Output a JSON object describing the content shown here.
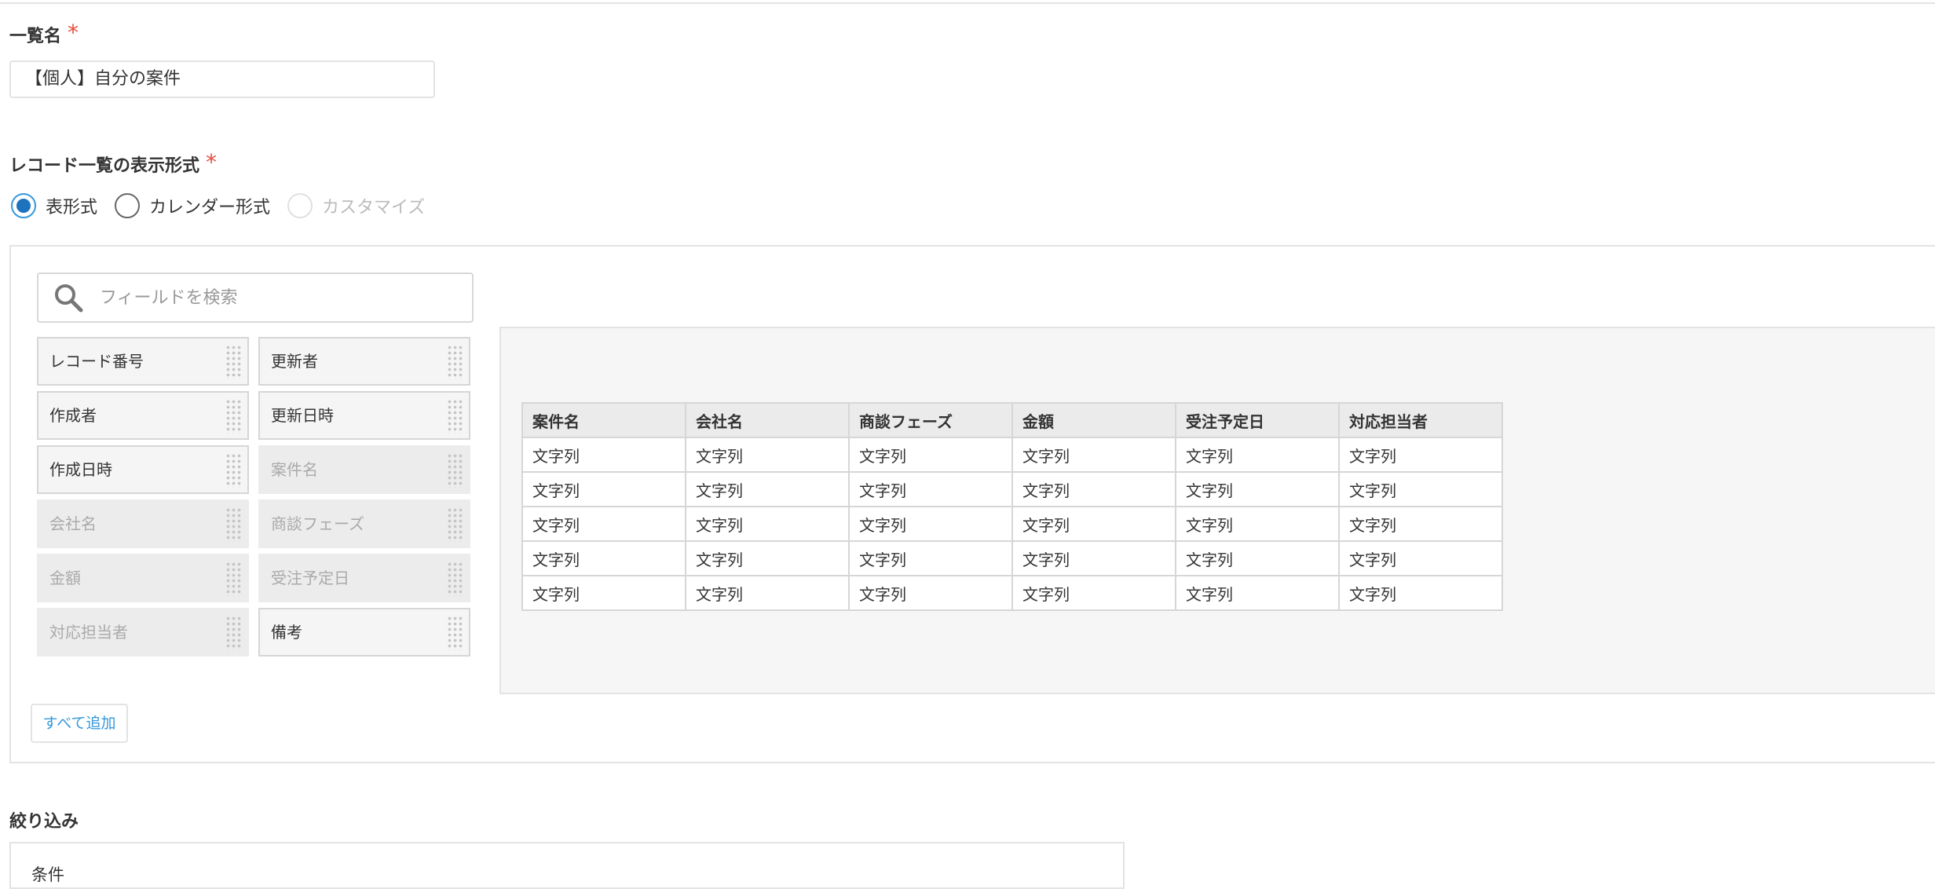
{
  "list_name": {
    "label": "一覧名",
    "required_mark": "*",
    "value": "【個人】自分の案件"
  },
  "display_format": {
    "label": "レコード一覧の表示形式",
    "required_mark": "*",
    "options": [
      {
        "label": "表形式",
        "checked": true,
        "disabled": false
      },
      {
        "label": "カレンダー形式",
        "checked": false,
        "disabled": false
      },
      {
        "label": "カスタマイズ",
        "checked": false,
        "disabled": true
      }
    ]
  },
  "field_search": {
    "placeholder": "フィールドを検索",
    "icon": "search-icon"
  },
  "fields": [
    {
      "label": "レコード番号",
      "used": false
    },
    {
      "label": "更新者",
      "used": false
    },
    {
      "label": "作成者",
      "used": false
    },
    {
      "label": "更新日時",
      "used": false
    },
    {
      "label": "作成日時",
      "used": false
    },
    {
      "label": "案件名",
      "used": true
    },
    {
      "label": "会社名",
      "used": true
    },
    {
      "label": "商談フェーズ",
      "used": true
    },
    {
      "label": "金額",
      "used": true
    },
    {
      "label": "受注予定日",
      "used": true
    },
    {
      "label": "対応担当者",
      "used": true
    },
    {
      "label": "備考",
      "used": false
    }
  ],
  "add_all_button": "すべて追加",
  "preview_table": {
    "columns": [
      "案件名",
      "会社名",
      "商談フェーズ",
      "金額",
      "受注予定日",
      "対応担当者"
    ],
    "rows": [
      [
        "文字列",
        "文字列",
        "文字列",
        "文字列",
        "文字列",
        "文字列"
      ],
      [
        "文字列",
        "文字列",
        "文字列",
        "文字列",
        "文字列",
        "文字列"
      ],
      [
        "文字列",
        "文字列",
        "文字列",
        "文字列",
        "文字列",
        "文字列"
      ],
      [
        "文字列",
        "文字列",
        "文字列",
        "文字列",
        "文字列",
        "文字列"
      ],
      [
        "文字列",
        "文字列",
        "文字列",
        "文字列",
        "文字列",
        "文字列"
      ]
    ]
  },
  "filter": {
    "label": "絞り込み",
    "condition_label": "条件"
  },
  "colors": {
    "required": "#e74c3c",
    "radio_selected": "#1e73be",
    "link_blue": "#3498db",
    "border": "#e3e3e3"
  }
}
